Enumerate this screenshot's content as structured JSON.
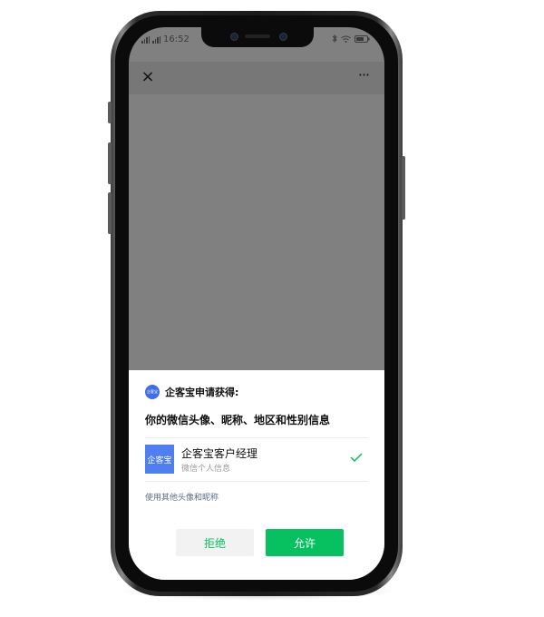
{
  "status_bar": {
    "signal_text": "46 46",
    "time": "16:52",
    "icons": [
      "signal-icon",
      "bluetooth-icon",
      "wifi-icon",
      "battery-icon"
    ]
  },
  "navbar": {
    "close_glyph": "×",
    "more_glyph": "···"
  },
  "auth_sheet": {
    "app_logo_text": "企客宝",
    "request_text": "企客宝申请获得:",
    "scope_text": "你的微信头像、昵称、地区和性别信息",
    "account": {
      "avatar_text": "企客宝",
      "name": "企客宝客户经理",
      "subtitle": "微信个人信息",
      "selected": true
    },
    "other_profile_link": "使用其他头像和昵称",
    "reject_label": "拒绝",
    "allow_label": "允许"
  },
  "colors": {
    "accent_green": "#07c160",
    "brand_blue": "#4e7ef0",
    "overlay_gray": "#808080"
  }
}
